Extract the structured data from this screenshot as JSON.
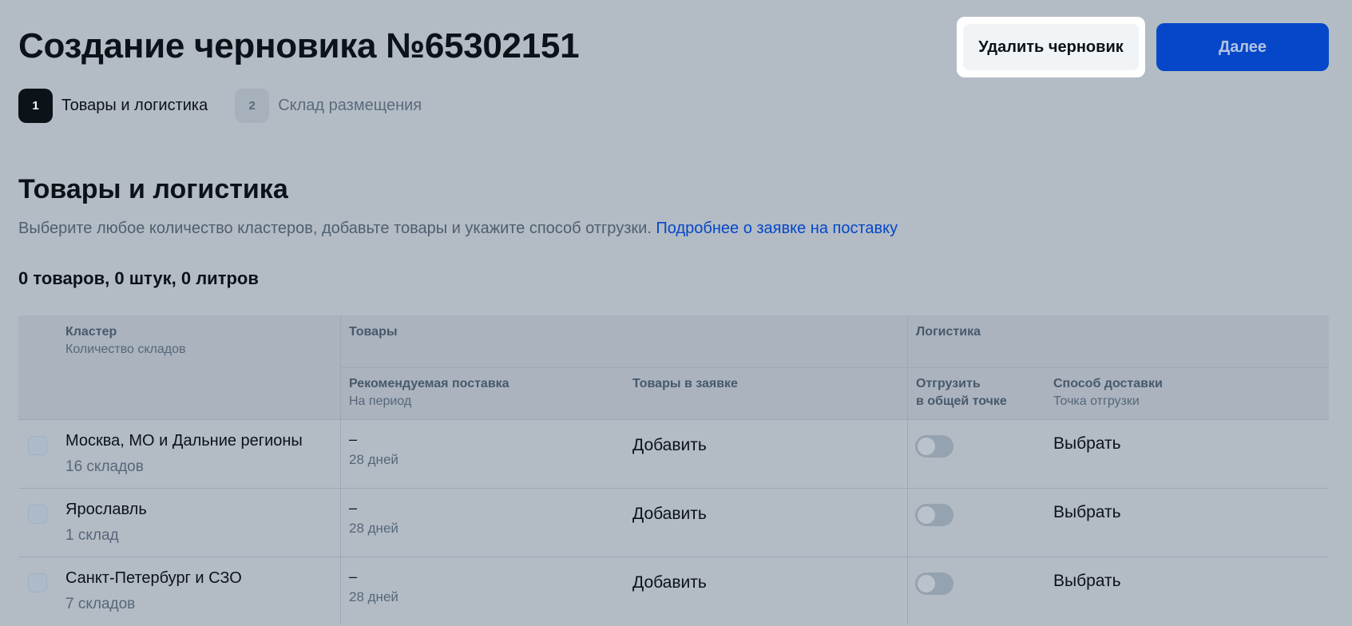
{
  "header": {
    "title": "Создание черновика №65302151",
    "delete_button": "Удалить черновик",
    "next_button": "Далее"
  },
  "stepper": {
    "steps": [
      {
        "number": "1",
        "label": "Товары и логистика",
        "active": true
      },
      {
        "number": "2",
        "label": "Склад размещения",
        "active": false
      }
    ]
  },
  "section": {
    "title": "Товары и логистика",
    "description": "Выберите любое количество кластеров, добавьте товары и укажите способ отгрузки.",
    "link": "Подробнее о заявке на поставку",
    "summary": "0 товаров, 0 штук, 0 литров"
  },
  "table": {
    "headers": {
      "cluster": "Кластер",
      "cluster_sub": "Количество складов",
      "goods": "Товары",
      "logistics": "Логистика",
      "recommended": "Рекомендуемая поставка",
      "recommended_sub": "На период",
      "in_request": "Товары в заявке",
      "ship_common_line1": "Отгрузить",
      "ship_common_line2": "в общей точке",
      "delivery_method": "Способ доставки",
      "delivery_method_sub": "Точка отгрузки"
    },
    "rows": [
      {
        "cluster": "Москва, МО и Дальние регионы",
        "count": "16 складов",
        "recommended": "–",
        "period": "28 дней",
        "add": "Добавить",
        "choose": "Выбрать",
        "ship_common": false
      },
      {
        "cluster": "Ярославль",
        "count": "1 склад",
        "recommended": "–",
        "period": "28 дней",
        "add": "Добавить",
        "choose": "Выбрать",
        "ship_common": false
      },
      {
        "cluster": "Санкт-Петербург и СЗО",
        "count": "7 складов",
        "recommended": "–",
        "period": "28 дней",
        "add": "Добавить",
        "choose": "Выбрать",
        "ship_common": false
      }
    ]
  },
  "colors": {
    "accent": "#0547c8",
    "background": "#b3bcc5",
    "text_primary": "#0b1218",
    "text_secondary": "#56677a"
  }
}
